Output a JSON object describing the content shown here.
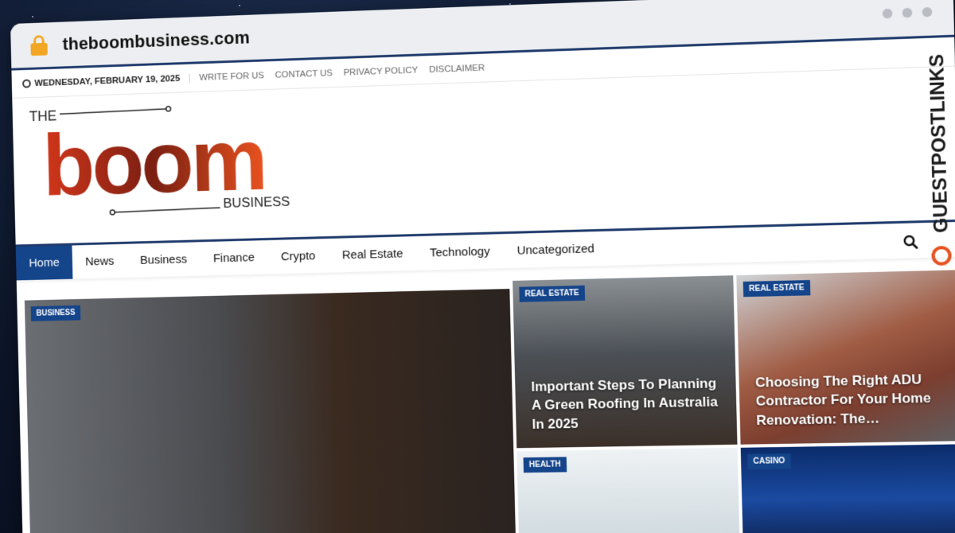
{
  "browser": {
    "url": "theboombusiness.com"
  },
  "topbar": {
    "date": "WEDNESDAY, FEBRUARY 19, 2025",
    "links": [
      "WRITE FOR US",
      "CONTACT US",
      "PRIVACY POLICY",
      "DISCLAIMER"
    ]
  },
  "logo": {
    "top_word": "THE",
    "main_word": "boom",
    "bottom_word": "BUSINESS"
  },
  "nav": {
    "items": [
      "Home",
      "News",
      "Business",
      "Finance",
      "Crypto",
      "Real Estate",
      "Technology",
      "Uncategorized"
    ],
    "active": "Home"
  },
  "cards": [
    {
      "category": "BUSINESS",
      "title": ""
    },
    {
      "category": "REAL ESTATE",
      "title": "Important Steps To Planning A Green Roofing In Australia In 2025"
    },
    {
      "category": "REAL ESTATE",
      "title": "Choosing The Right ADU Contractor For Your Home Renovation: The…"
    },
    {
      "category": "HEALTH",
      "title": ""
    },
    {
      "category": "CASINO",
      "title": ""
    }
  ],
  "watermark": {
    "text": "GUESTPOSTLINKS"
  },
  "colors": {
    "accent": "#14448a",
    "logo_orange": "#e04a1c",
    "lock": "#f2a623"
  },
  "icons": {
    "lock": "lock-icon",
    "clock": "clock-icon",
    "search": "search-icon"
  }
}
